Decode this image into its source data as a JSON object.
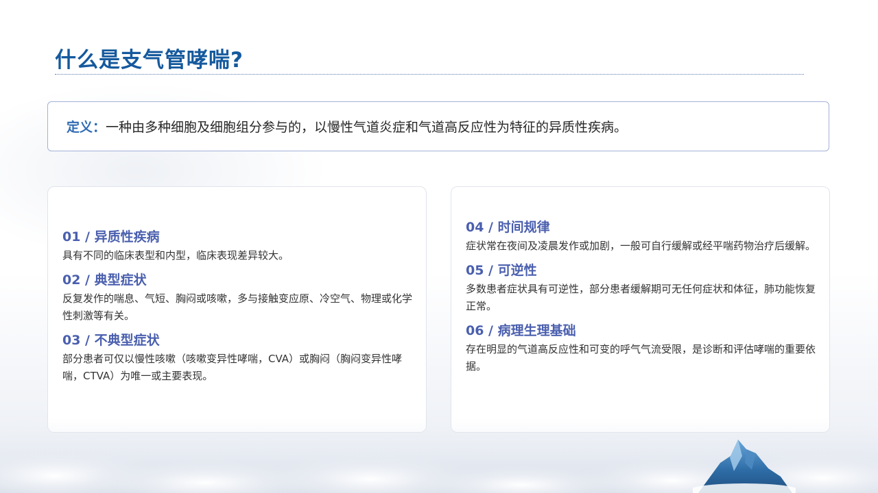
{
  "header": {
    "title": "什么是支气管哮喘?"
  },
  "definition": {
    "label": "定义：",
    "text": "一种由多种细胞及细胞组分参与的，以慢性气道炎症和气道高反应性为特征的异质性疾病。"
  },
  "left_card": {
    "items": [
      {
        "heading": "01 / 异质性疾病",
        "body": "具有不同的临床表型和内型，临床表现差异较大。"
      },
      {
        "heading": "02 / 典型症状",
        "body": "反复发作的喘息、气短、胸闷或咳嗽，多与接触变应原、冷空气、物理或化学性刺激等有关。"
      },
      {
        "heading": "03 / 不典型症状",
        "body": "部分患者可仅以慢性咳嗽（咳嗽变异性哮喘，CVA）或胸闷（胸闷变异性哮喘，CTVA）为唯一或主要表现。"
      }
    ]
  },
  "right_card": {
    "items": [
      {
        "heading": "04 / 时间规律",
        "body": "症状常在夜间及凌晨发作或加剧，一般可自行缓解或经平喘药物治疗后缓解。"
      },
      {
        "heading": "05 / 可逆性",
        "body": "多数患者症状具有可逆性，部分患者缓解期可无任何症状和体征，肺功能恢复正常。"
      },
      {
        "heading": "06 / 病理生理基础",
        "body": "存在明显的气道高反应性和可变的呼气气流受限，是诊断和评估哮喘的重要依据。"
      }
    ]
  },
  "colors": {
    "title": "#15599d",
    "heading": "#4a5fae",
    "definition_label": "#2f6cb3",
    "border": "#a3b1d9"
  }
}
